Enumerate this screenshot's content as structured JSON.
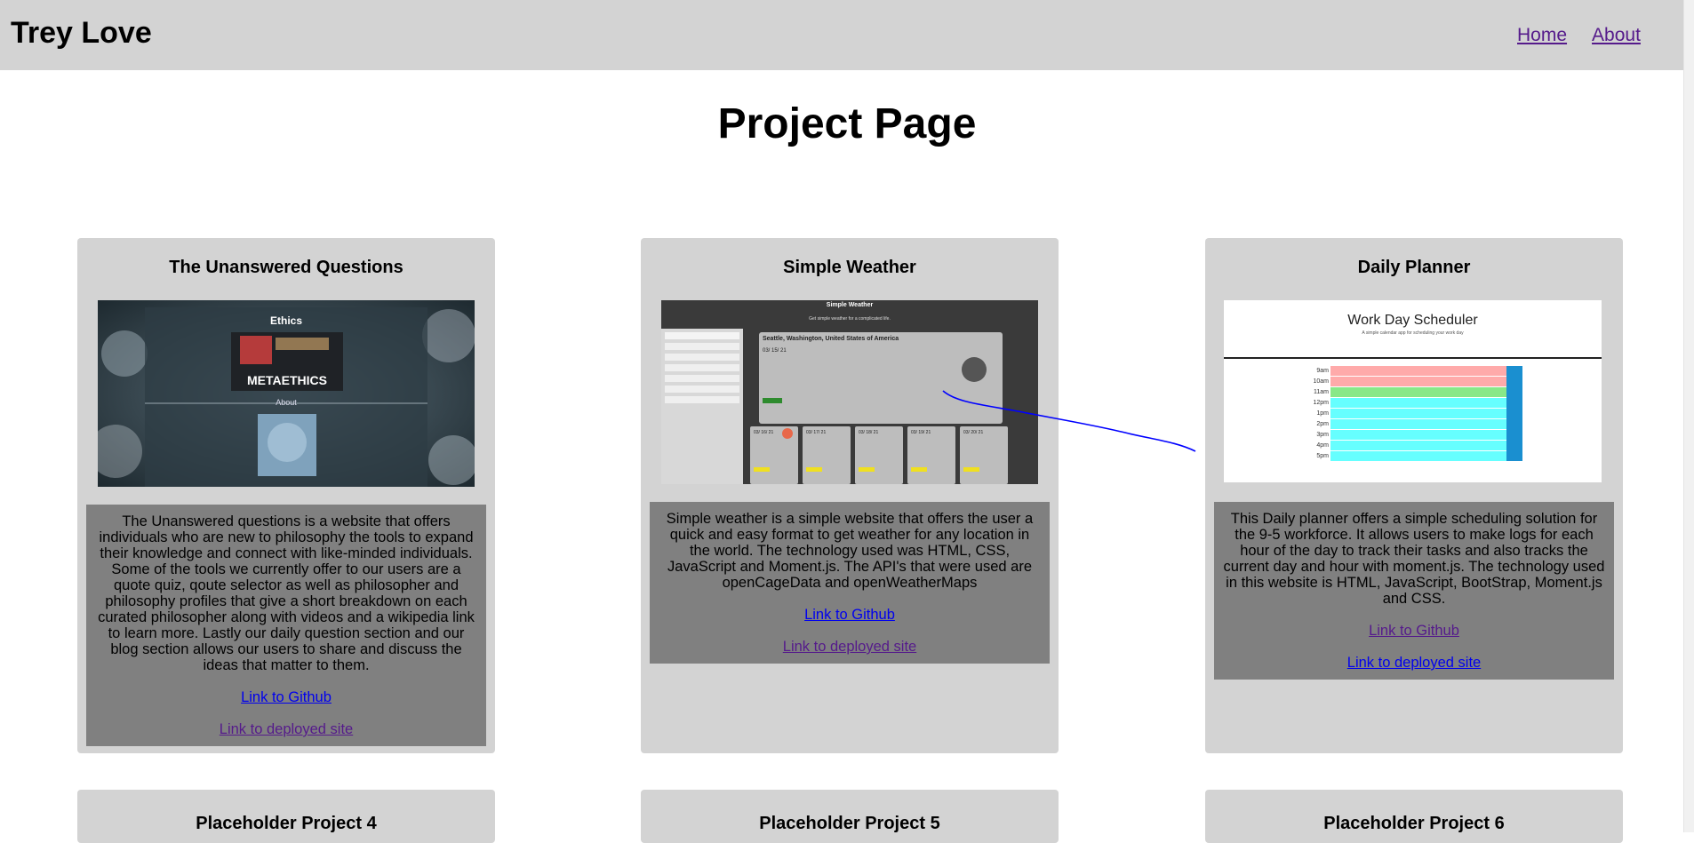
{
  "header": {
    "brand": "Trey Love",
    "nav": [
      "Home",
      "About"
    ]
  },
  "page_title": "Project Page",
  "projects": [
    {
      "title": "The Unanswered Questions",
      "description": "The Unanswered questions is a website that offers individuals who are new to philosophy the tools to expand their knowledge and connect with like-minded individuals. Some of the tools we currently offer to our users are a quote quiz, qoute selector as well as philosopher and philosophy profiles that give a short breakdown on each curated philosopher along with videos and a wikipedia link to learn more. Lastly our daily question section and our blog section allows our users to share and discuss the ideas that matter to them.",
      "github_link": "Link to Github",
      "deployed_link": "Link to deployed site",
      "screenshot": {
        "heading": "Ethics",
        "banner": "METAETHICS",
        "section": "About"
      }
    },
    {
      "title": "Simple Weather",
      "description": "Simple weather is a simple website that offers the user a quick and easy format to get weather for any location in the world. The technology used was HTML, CSS, JavaScript and Moment.js. The API's that were used are openCageData and openWeatherMaps",
      "github_link": "Link to Github",
      "deployed_link": "Link to deployed site",
      "screenshot": {
        "app_title": "Simple Weather",
        "tagline": "Get simple weather for a complicated life.",
        "city": "Seattle, Washington, United States of America",
        "date": "03/ 15/ 21",
        "forecast_dates": [
          "03/ 16/ 21",
          "03/ 17/ 21",
          "03/ 18/ 21",
          "03/ 19/ 21",
          "03/ 20/ 21"
        ]
      }
    },
    {
      "title": "Daily Planner",
      "description": "This Daily planner offers a simple scheduling solution for the 9-5 workforce. It allows users to make logs for each hour of the day to track their tasks and also tracks the current day and hour with moment.js. The technology used in this website is HTML, JavaScript, BootStrap, Moment.js and CSS.",
      "github_link": "Link to Github",
      "deployed_link": "Link to deployed site",
      "screenshot": {
        "app_title": "Work Day Scheduler",
        "subtitle": "A simple calendar app for scheduling your work day",
        "hours": [
          "9am",
          "10am",
          "11am",
          "12pm",
          "1pm",
          "2pm",
          "3pm",
          "4pm",
          "5pm"
        ]
      }
    }
  ],
  "placeholders": [
    "Placeholder Project 4",
    "Placeholder Project 5",
    "Placeholder Project 6"
  ],
  "colors": {
    "header_bg": "#d3d3d3",
    "card_bg": "#d3d3d3",
    "desc_bg": "#808080",
    "link": "#0000ee",
    "visited": "#551a8b",
    "annotation_stroke": "#0000ff"
  }
}
